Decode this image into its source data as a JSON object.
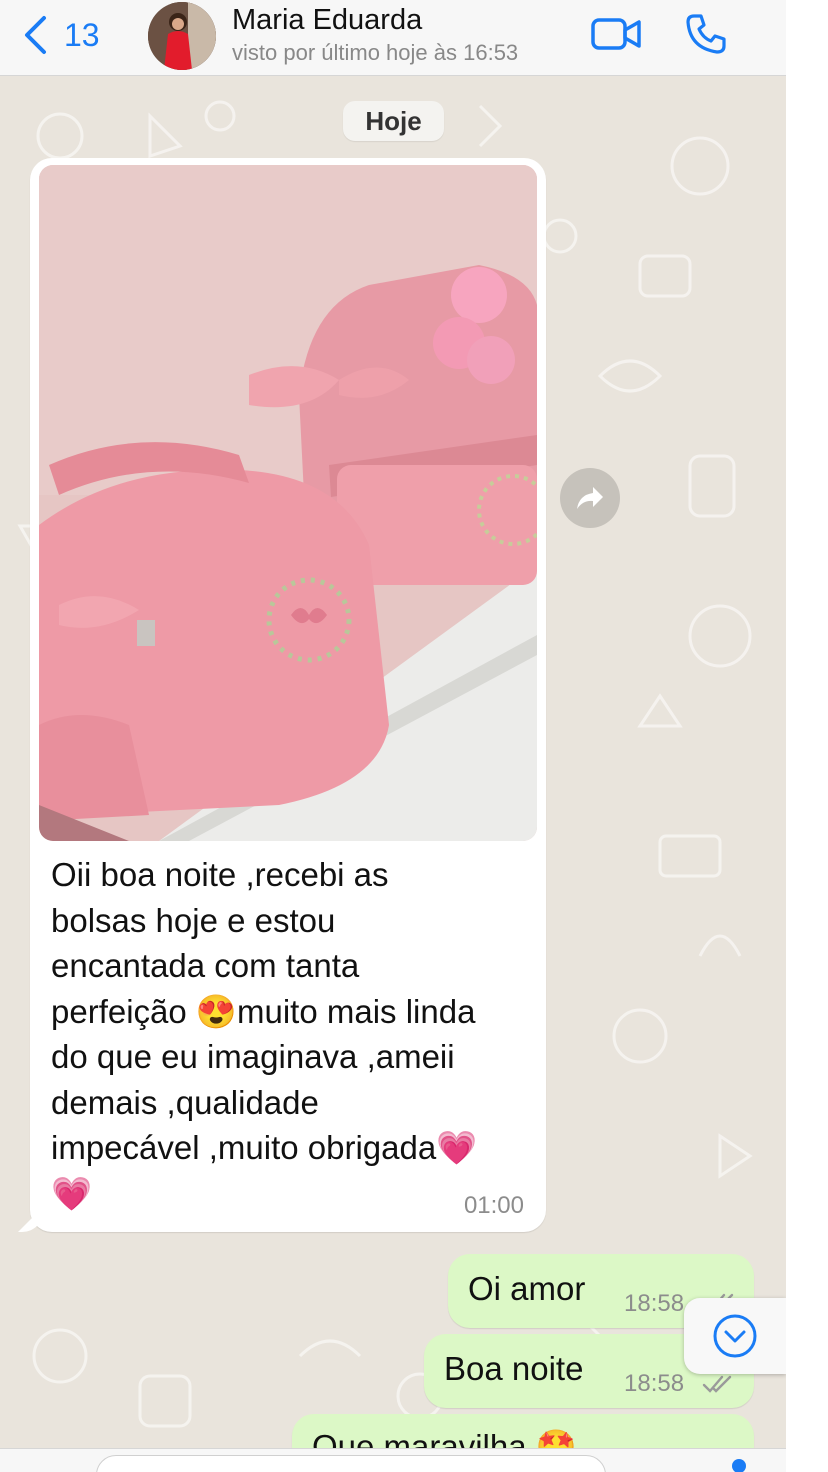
{
  "header": {
    "back_count": "13",
    "contact_name": "Maria Eduarda",
    "last_seen": "visto por último hoje às 16:53"
  },
  "chat": {
    "date_label": "Hoje",
    "incoming": {
      "text": "Oii boa noite ,recebi as\nbolsas hoje e estou\nencantada com tanta\nperfeição 😍muito mais linda\ndo que eu imaginava ,ameii\ndemais ,qualidade\nimpecável ,muito obrigada💗\n💗",
      "time": "01:00"
    },
    "outgoing": [
      {
        "text": "Oi amor",
        "time": "18:58"
      },
      {
        "text": "Boa noite",
        "time": "18:58"
      },
      {
        "text": "Que maravilha 🤩"
      }
    ]
  },
  "colors": {
    "accent": "#1a7cf5",
    "outgoing_bubble": "#dcf8c6",
    "wallpaper": "#e9e4dc"
  }
}
